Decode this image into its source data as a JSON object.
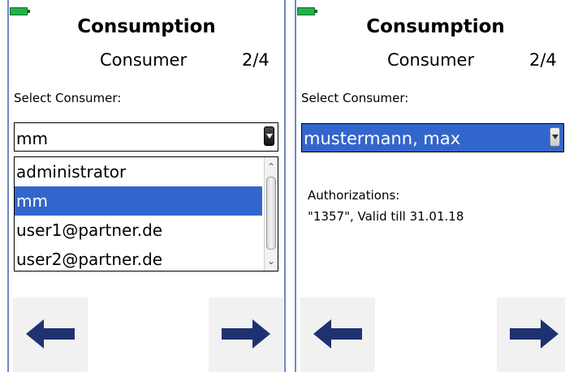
{
  "left_panel": {
    "title": "Consumption",
    "subtitle": "Consumer",
    "page_indicator": "2/4",
    "select_label": "Select Consumer:",
    "combo_value": "mm",
    "list_items": [
      {
        "label": "administrator",
        "selected": false
      },
      {
        "label": "mm",
        "selected": true
      },
      {
        "label": "user1@partner.de",
        "selected": false
      },
      {
        "label": "user2@partner.de",
        "selected": false
      }
    ]
  },
  "right_panel": {
    "title": "Consumption",
    "subtitle": "Consumer",
    "page_indicator": "2/4",
    "select_label": "Select Consumer:",
    "combo_value": "mustermann, max",
    "authorizations_label": "Authorizations:",
    "authorization_entry": "\"1357\", Valid till 31.01.18"
  },
  "colors": {
    "accent": "#3366cc",
    "battery": "#22b14c",
    "arrow": "#1f3270",
    "panel_border": "#6f86c8"
  },
  "icons": {
    "battery": "battery-icon",
    "back": "arrow-left-icon",
    "next": "arrow-right-icon"
  }
}
